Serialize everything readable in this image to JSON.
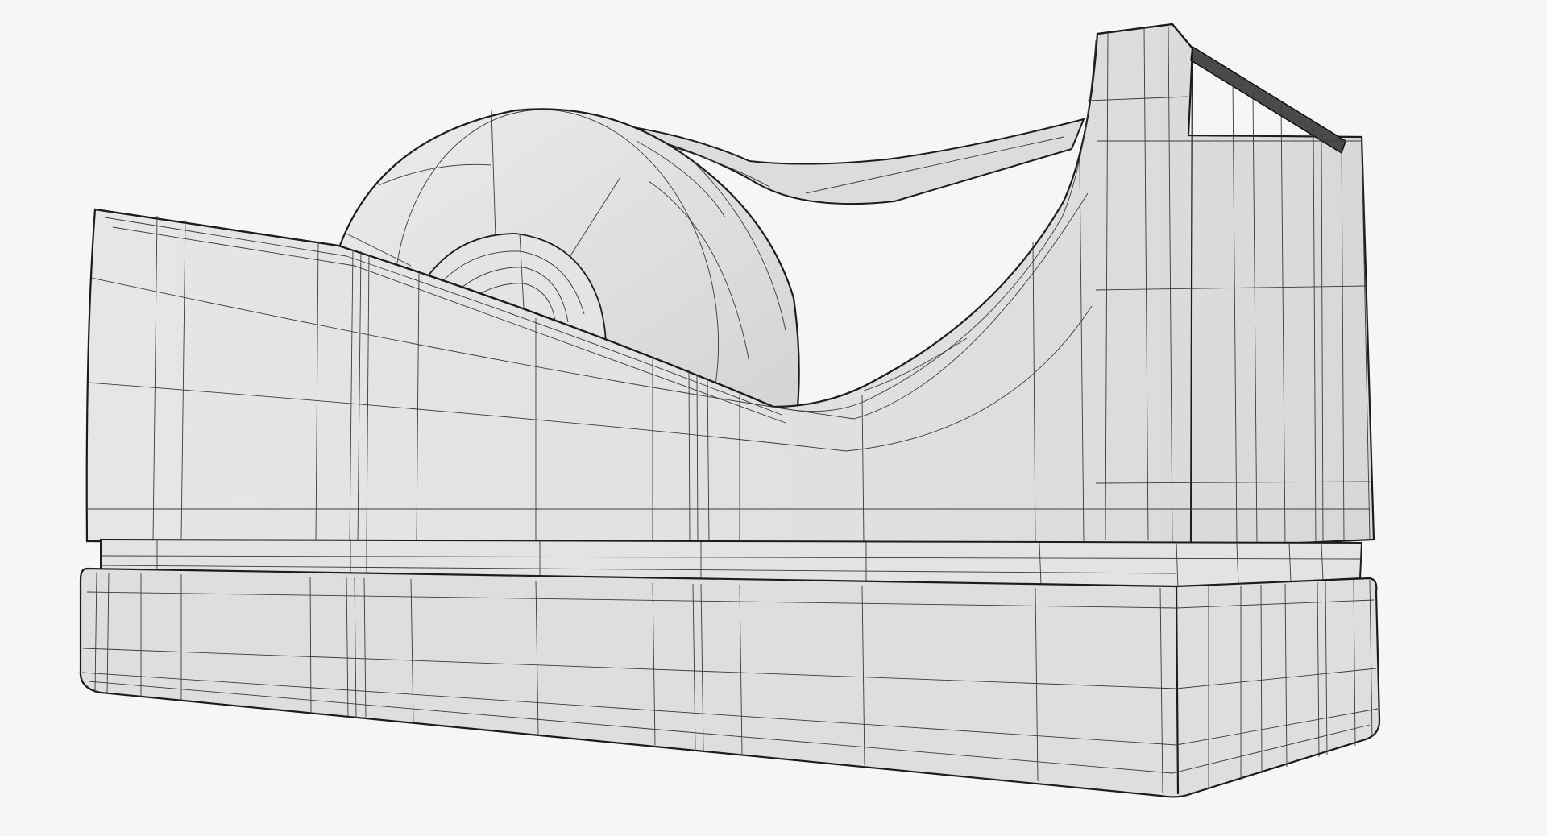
{
  "scene": {
    "subject": "tape-dispenser",
    "background_color": "#f6f6f6",
    "surface_color": "#e2e2e2",
    "wire_color": "#333333"
  }
}
